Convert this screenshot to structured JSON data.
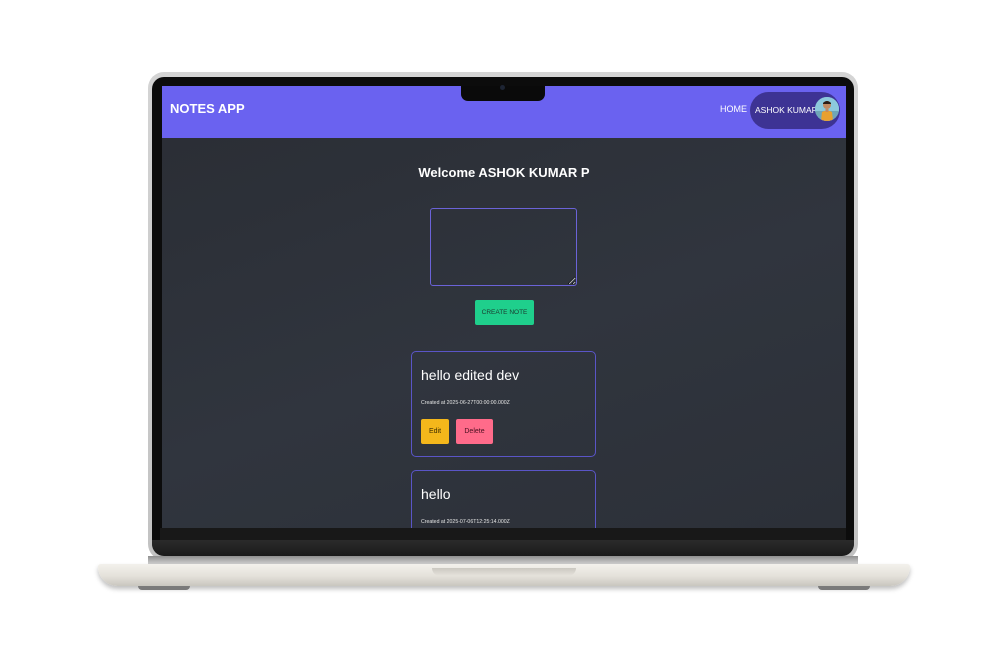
{
  "navbar": {
    "brand": "NOTES APP",
    "home_link": "HOME",
    "user_name": "ASHOK KUMAR P"
  },
  "main": {
    "welcome": "Welcome ASHOK KUMAR P",
    "note_input": {
      "value": "",
      "placeholder": ""
    },
    "create_button": "CREATE NOTE"
  },
  "notes": [
    {
      "title": "hello edited dev",
      "created": "Created at 2025-06-27T00:00:00.000Z",
      "edit_label": "Edit",
      "delete_label": "Delete"
    },
    {
      "title": "hello",
      "created": "Created at 2025-07-06T12:25:14.000Z"
    }
  ],
  "colors": {
    "navbar": "#6a62f0",
    "user_pill": "#3d3394",
    "background": "#2c3038",
    "create_button": "#1fcf8c",
    "edit_button": "#f4b71b",
    "delete_button": "#ff6b8a",
    "card_border": "#5a55c7"
  }
}
